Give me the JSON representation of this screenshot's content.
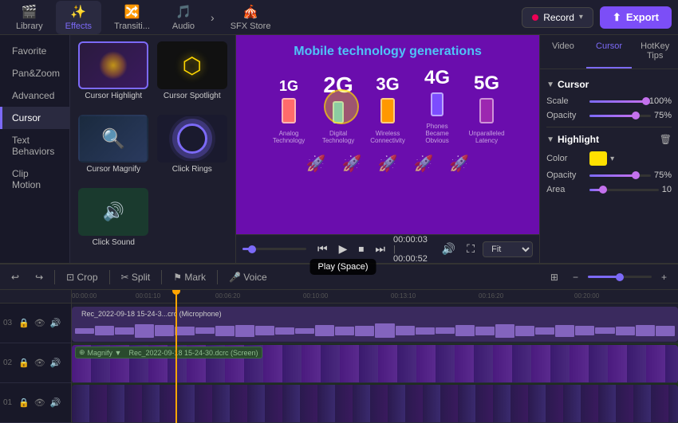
{
  "toolbar": {
    "tabs": [
      {
        "id": "library",
        "label": "Library",
        "icon": "🎬"
      },
      {
        "id": "effects",
        "label": "Effects",
        "icon": "✨",
        "active": true
      },
      {
        "id": "transitions",
        "label": "Transiti...",
        "icon": "🔀"
      },
      {
        "id": "audio",
        "label": "Audio",
        "icon": "🎵"
      },
      {
        "id": "sfx",
        "label": "SFX Store",
        "icon": "🎪"
      }
    ],
    "record_label": "Record",
    "export_label": "Export"
  },
  "effects_nav": {
    "items": [
      {
        "id": "favorite",
        "label": "Favorite"
      },
      {
        "id": "panzoom",
        "label": "Pan&Zoom"
      },
      {
        "id": "advanced",
        "label": "Advanced"
      },
      {
        "id": "cursor",
        "label": "Cursor",
        "active": true
      },
      {
        "id": "text",
        "label": "Text Behaviors"
      },
      {
        "id": "clip",
        "label": "Clip Motion"
      }
    ]
  },
  "effects_grid": [
    {
      "id": "cursor-highlight",
      "label": "Cursor Highlight",
      "selected": true
    },
    {
      "id": "cursor-spotlight",
      "label": "Cursor Spotlight"
    },
    {
      "id": "cursor-magnify",
      "label": "Cursor Magnify"
    },
    {
      "id": "click-rings",
      "label": "Click Rings"
    },
    {
      "id": "click-sound",
      "label": "Click Sound"
    }
  ],
  "preview": {
    "title": "Mobile technology generations",
    "generations": [
      "1G",
      "2G",
      "3G",
      "4G",
      "5G"
    ],
    "timestamp_current": "00:00:03",
    "timestamp_total": "00:00:52",
    "fit_label": "Fit",
    "tooltip": "Play (Space)"
  },
  "right_panel": {
    "tabs": [
      "Video",
      "Cursor",
      "HotKey Tips"
    ],
    "active_tab": "Cursor",
    "cursor_section": {
      "title": "Cursor",
      "scale_label": "Scale",
      "scale_value": "100%",
      "opacity_label": "Opacity",
      "opacity_value": "75%",
      "scale_pct": 100,
      "opacity_pct": 75
    },
    "highlight_section": {
      "title": "Highlight",
      "color_label": "Color",
      "color_value": "#ffe000",
      "opacity_label": "Opacity",
      "opacity_value": "75%",
      "area_label": "Area",
      "area_value": "10",
      "opacity_pct": 75
    }
  },
  "timeline": {
    "toolbar_buttons": [
      "undo",
      "redo",
      "crop",
      "split",
      "mark",
      "voice"
    ],
    "toolbar_labels": [
      "↩",
      "↪",
      "⊡ Crop",
      "✂ Split",
      "⚑ Mark",
      "🎤 Voice"
    ],
    "tracks": [
      {
        "num": "03",
        "type": "audio",
        "label": "Rec_2022-09-18 15-24-3...crc (Microphone)"
      },
      {
        "num": "02",
        "type": "video",
        "label": "Rec_2022-09-18 15-24-30.dcrc (Screen)",
        "badge": "Magnify ▼"
      },
      {
        "num": "01",
        "type": "video",
        "label": ""
      }
    ],
    "ruler_marks": [
      "00:00:00",
      "00:01:10",
      "00:06:20",
      "00:10:00",
      "00:13:10",
      "00:16:20",
      "00:20:00"
    ]
  }
}
